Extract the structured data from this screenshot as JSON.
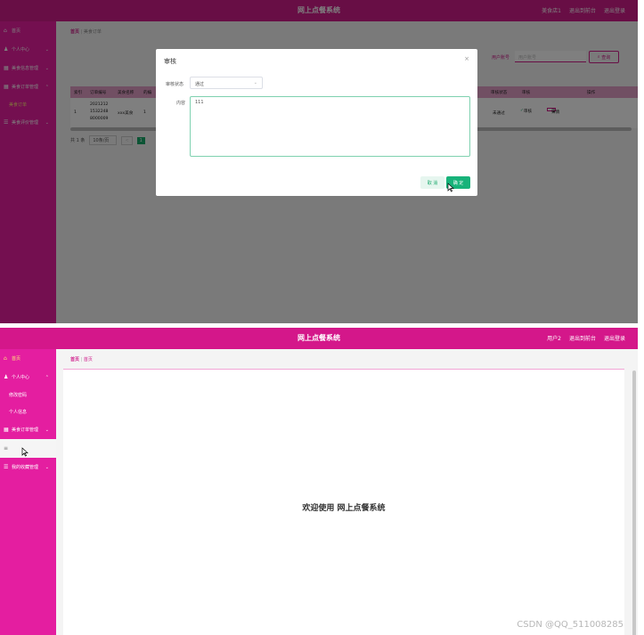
{
  "shot1": {
    "app_title": "网上点餐系统",
    "header_right": [
      "美食店1",
      "退出到前台",
      "退出登录"
    ],
    "sidebar": [
      {
        "label": "首页",
        "icon": "home-icon"
      },
      {
        "label": "个人中心",
        "icon": "user-icon"
      },
      {
        "label": "美食信息管理",
        "icon": "grid-icon"
      },
      {
        "label": "美食订单管理",
        "icon": "grid-icon"
      },
      {
        "label": "美食订单",
        "sub": true
      },
      {
        "label": "美食评价管理",
        "icon": "list-icon"
      }
    ],
    "breadcrumb": [
      "首页",
      "美食订单"
    ],
    "search": {
      "label": "用户账号",
      "placeholder": "用户账号",
      "button": "查询"
    },
    "table": {
      "headers": [
        "索引",
        "订单编号",
        "美食名称",
        "的编",
        "",
        "审核状态",
        "审核",
        "操作"
      ],
      "row": {
        "index": "1",
        "order_no": "2021212 1532248 8000009",
        "food": "xxx美食",
        "col4": "1",
        "status": "未通过",
        "review_btn": "审核",
        "detail_btn": "详情"
      }
    },
    "pagination": {
      "total": "共 1 条",
      "size": "10条/页",
      "prev": "<",
      "page": "1"
    },
    "dialog": {
      "title": "审核",
      "close": "×",
      "status_label": "审核状态",
      "status_value": "通过",
      "content_label": "内容",
      "content_value": "111",
      "cancel": "取 消",
      "confirm": "确 定"
    },
    "colors": {
      "header": "#7a0a4e",
      "sidebar": "#7e1258",
      "accent": "#18a86a"
    }
  },
  "shot2": {
    "app_title": "网上点餐系统",
    "header_right": [
      "用户2",
      "退出到前台",
      "退出登录"
    ],
    "sidebar": [
      {
        "label": "首页",
        "icon": "home-icon"
      },
      {
        "label": "个人中心",
        "icon": "user-icon"
      },
      {
        "label": "修改密码",
        "sub": true
      },
      {
        "label": "个人信息",
        "sub": true
      },
      {
        "label": "美食订单管理",
        "icon": "grid-icon"
      },
      {
        "label": "",
        "icon": "menu-icon",
        "hovered": true
      },
      {
        "label": "我的收藏管理",
        "icon": "list-icon"
      }
    ],
    "breadcrumb": [
      "首页",
      "首页"
    ],
    "welcome": "欢迎使用 网上点餐系统",
    "watermark": "CSDN @QQ_511008285",
    "colors": {
      "header": "#d4178a",
      "sidebar": "#e41ea0"
    }
  }
}
